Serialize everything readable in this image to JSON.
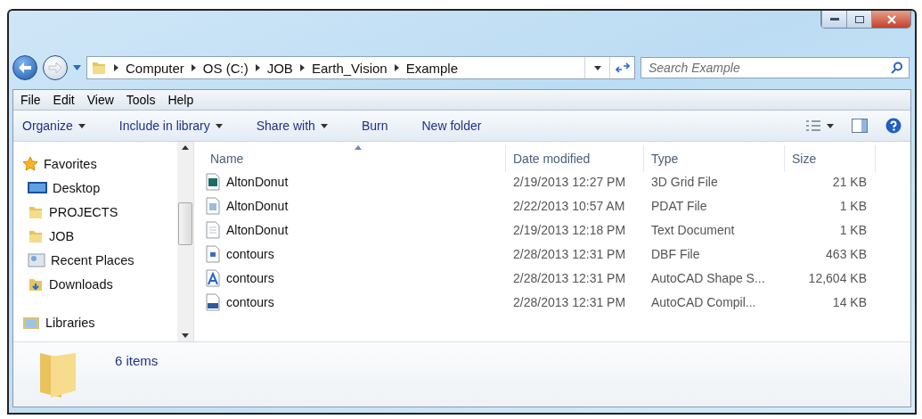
{
  "address": {
    "crumbs": [
      "Computer",
      "OS (C:)",
      "JOB",
      "Earth_Vision",
      "Example"
    ]
  },
  "search": {
    "placeholder": "Search Example"
  },
  "menu": [
    "File",
    "Edit",
    "View",
    "Tools",
    "Help"
  ],
  "toolbar": [
    {
      "label": "Organize",
      "dropdown": true
    },
    {
      "label": "Include in library",
      "dropdown": true
    },
    {
      "label": "Share with",
      "dropdown": true
    },
    {
      "label": "Burn",
      "dropdown": false
    },
    {
      "label": "New folder",
      "dropdown": false
    }
  ],
  "sidebar": {
    "items": [
      {
        "label": "Favorites",
        "kind": "star"
      },
      {
        "label": "Desktop",
        "kind": "desktop"
      },
      {
        "label": "PROJECTS",
        "kind": "folder"
      },
      {
        "label": "JOB",
        "kind": "folder"
      },
      {
        "label": "Recent Places",
        "kind": "recent"
      },
      {
        "label": "Downloads",
        "kind": "downloads"
      },
      {
        "label": "Libraries",
        "kind": "libraries"
      }
    ]
  },
  "table": {
    "columns": [
      {
        "label": "Name",
        "sorted": true
      },
      {
        "label": "Date modified",
        "sorted": false
      },
      {
        "label": "Type",
        "sorted": false
      },
      {
        "label": "Size",
        "sorted": false
      }
    ],
    "rows": [
      {
        "kind": "grid",
        "name": "AltonDonut",
        "date": "2/19/2013 12:27 PM",
        "type": "3D Grid File",
        "size": "21 KB"
      },
      {
        "kind": "pdat",
        "name": "AltonDonut",
        "date": "2/22/2013 10:57 AM",
        "type": "PDAT File",
        "size": "1 KB"
      },
      {
        "kind": "text",
        "name": "AltonDonut",
        "date": "2/19/2013 12:18 PM",
        "type": "Text Document",
        "size": "1 KB"
      },
      {
        "kind": "dbf",
        "name": "contours",
        "date": "2/28/2013 12:31 PM",
        "type": "DBF File",
        "size": "463 KB"
      },
      {
        "kind": "shape",
        "name": "contours",
        "date": "2/28/2013 12:31 PM",
        "type": "AutoCAD Shape S...",
        "size": "12,604 KB"
      },
      {
        "kind": "shx",
        "name": "contours",
        "date": "2/28/2013 12:31 PM",
        "type": "AutoCAD Compil...",
        "size": "14 KB"
      }
    ]
  },
  "status_bar": {
    "count": "6 items"
  }
}
